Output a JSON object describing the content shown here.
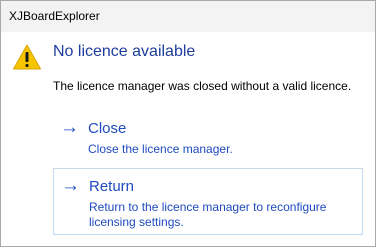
{
  "window": {
    "title": "XJBoardExplorer"
  },
  "dialog": {
    "icon": "warning-icon",
    "heading": "No licence available",
    "message": "The licence manager was closed without a valid licence."
  },
  "commands": [
    {
      "icon": "right-arrow-icon",
      "title": "Close",
      "description": "Close the licence manager."
    },
    {
      "icon": "right-arrow-icon",
      "title": "Return",
      "description": "Return to the licence manager to reconfigure licensing settings."
    }
  ],
  "colors": {
    "heading": "#1f3d9e",
    "link": "#1f4bbf",
    "warning_fill": "#f7c400"
  }
}
